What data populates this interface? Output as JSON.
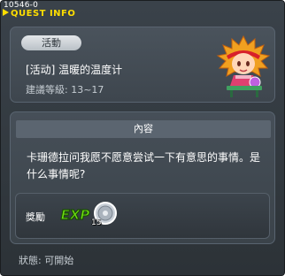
{
  "header": {
    "code": "10546-0",
    "title": "QUEST INFO"
  },
  "quest": {
    "tag": "活動",
    "name": "[活动] 温暖的温度计",
    "level": "建議等級: 13~17"
  },
  "content": {
    "header": "內容",
    "text": "卡珊德拉问我愿不愿意尝试一下有意思的事情。是什么事情呢?"
  },
  "reward": {
    "label": "獎勵",
    "exp_icon_text": "EXP",
    "coin_count": "15"
  },
  "status": "狀態: 可開始",
  "colors": {
    "title": "#ffde00",
    "window_bg": "#343b41",
    "panel_bg": "#434b53"
  },
  "icons": {
    "npc": "npc-portrait",
    "exp": "exp-icon",
    "reward_item": "coin-icon"
  }
}
